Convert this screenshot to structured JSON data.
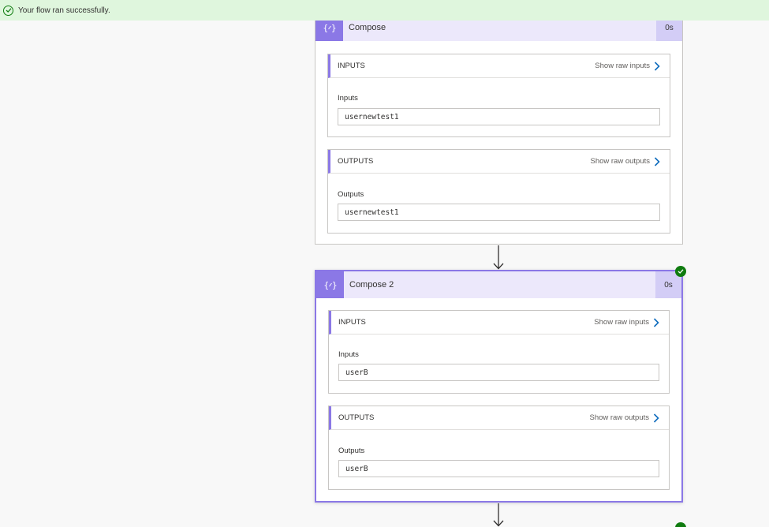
{
  "banner": {
    "message": "Your flow ran successfully."
  },
  "actions": [
    {
      "title": "Compose",
      "duration": "0s",
      "inputs_header": "INPUTS",
      "show_raw_inputs": "Show raw inputs",
      "inputs_label": "Inputs",
      "inputs_value": "usernewtest1",
      "outputs_header": "OUTPUTS",
      "show_raw_outputs": "Show raw outputs",
      "outputs_label": "Outputs",
      "outputs_value": "usernewtest1"
    },
    {
      "title": "Compose 2",
      "duration": "0s",
      "inputs_header": "INPUTS",
      "show_raw_inputs": "Show raw inputs",
      "inputs_label": "Inputs",
      "inputs_value": "userB",
      "outputs_header": "OUTPUTS",
      "show_raw_outputs": "Show raw outputs",
      "outputs_label": "Outputs",
      "outputs_value": "userB"
    }
  ],
  "colors": {
    "accent": "#8b78e6",
    "header_bg": "#ece8fb",
    "success": "#107c10",
    "banner_bg": "#dff6dd"
  }
}
